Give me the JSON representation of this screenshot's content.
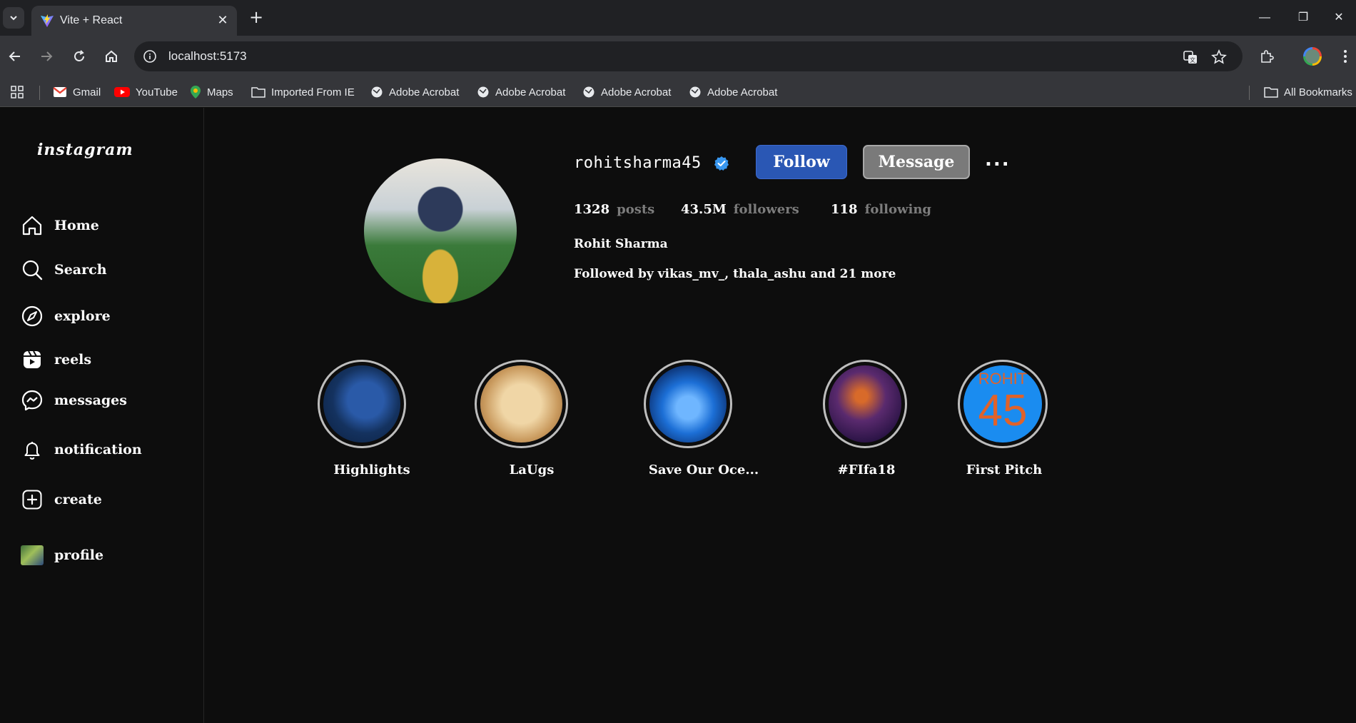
{
  "browser": {
    "tab_title": "Vite + React",
    "tab_close": "✕",
    "new_tab": "+",
    "url": "localhost:5173",
    "bookmarks": [
      "Gmail",
      "YouTube",
      "Maps",
      "Imported From IE",
      "Adobe Acrobat",
      "Adobe Acrobat",
      "Adobe Acrobat",
      "Adobe Acrobat"
    ],
    "all_bookmarks": "All Bookmarks"
  },
  "app": {
    "logo": "instagram",
    "nav": [
      {
        "label": "Home",
        "icon": "home-icon"
      },
      {
        "label": "Search",
        "icon": "search-icon"
      },
      {
        "label": "explore",
        "icon": "compass-icon"
      },
      {
        "label": "reels",
        "icon": "reels-icon"
      },
      {
        "label": "messages",
        "icon": "messenger-icon"
      },
      {
        "label": "notification",
        "icon": "bell-icon"
      },
      {
        "label": "create",
        "icon": "plus-square-icon"
      },
      {
        "label": "profile",
        "icon": "profile-thumbnail"
      }
    ],
    "profile": {
      "username": "rohitsharma45",
      "follow_label": "Follow",
      "message_label": "Message",
      "more_label": "...",
      "posts_count": "1328",
      "posts_label": "posts",
      "followers_count": "43.5M",
      "followers_label": "followers",
      "following_count": "118",
      "following_label": "following",
      "full_name": "Rohit Sharma",
      "followed_by": "Followed by vikas_mv_, thala_ashu and 21 more"
    },
    "highlights": [
      {
        "label": "Highlights"
      },
      {
        "label": "LaUgs"
      },
      {
        "label": "Save Our Oce..."
      },
      {
        "label": "#FIfa18"
      },
      {
        "label": "First Pitch",
        "cover_top": "ROHIT",
        "cover_num": "45"
      }
    ]
  },
  "colors": {
    "follow": "#2a57b4",
    "message": "#7a7a7a",
    "verified": "#3897f0",
    "accent_orange": "#e0622a",
    "background": "#0d0d0d"
  }
}
